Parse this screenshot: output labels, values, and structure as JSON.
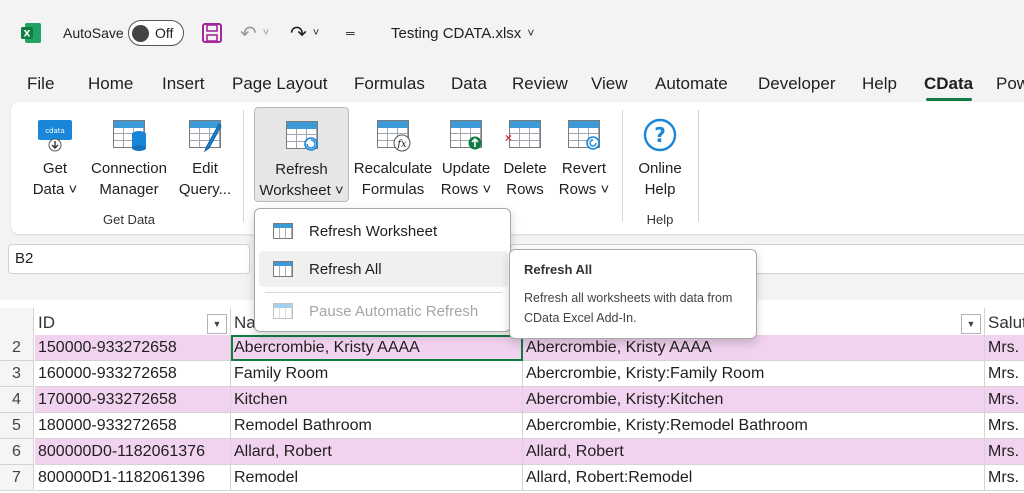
{
  "titlebar": {
    "autosave_label": "AutoSave",
    "autosave_state": "Off",
    "file_title": "Testing CDATA.xlsx"
  },
  "tabs": [
    {
      "label": "File"
    },
    {
      "label": "Home"
    },
    {
      "label": "Insert"
    },
    {
      "label": "Page Layout"
    },
    {
      "label": "Formulas"
    },
    {
      "label": "Data"
    },
    {
      "label": "Review"
    },
    {
      "label": "View"
    },
    {
      "label": "Automate"
    },
    {
      "label": "Developer"
    },
    {
      "label": "Help"
    },
    {
      "label": "CData"
    },
    {
      "label": "Pow"
    }
  ],
  "active_tab": "CData",
  "ribbon": {
    "get_data": {
      "line1": "Get",
      "line2": "Data ˅"
    },
    "connection_manager": {
      "line1": "Connection",
      "line2": "Manager"
    },
    "edit_query": {
      "line1": "Edit",
      "line2": "Query..."
    },
    "group_get_data": "Get Data",
    "refresh_worksheet": {
      "line1": "Refresh",
      "line2": "Worksheet ˅"
    },
    "recalculate": {
      "line1": "Recalculate",
      "line2": "Formulas"
    },
    "update_rows": {
      "line1": "Update",
      "line2": "Rows ˅"
    },
    "delete_rows": {
      "line1": "Delete",
      "line2": "Rows"
    },
    "revert_rows": {
      "line1": "Revert",
      "line2": "Rows ˅"
    },
    "online_help": {
      "line1": "Online",
      "line2": "Help"
    },
    "group_help": "Help"
  },
  "namebox": "B2",
  "dropdown": {
    "items": [
      {
        "label": "Refresh Worksheet",
        "state": "normal"
      },
      {
        "label": "Refresh All",
        "state": "hover"
      },
      {
        "label": "Pause Automatic Refresh",
        "state": "disabled"
      }
    ]
  },
  "tooltip": {
    "title": "Refresh All",
    "body": "Refresh all worksheets with data from CData Excel Add-In."
  },
  "sheet": {
    "headers": [
      "ID",
      "Na",
      "",
      "Salut"
    ],
    "rows": [
      {
        "num": "2",
        "id": "150000-933272658",
        "name": "Abercrombie, Kristy AAAA",
        "full": "Abercrombie, Kristy AAAA",
        "sal": "Mrs."
      },
      {
        "num": "3",
        "id": "160000-933272658",
        "name": "Family Room",
        "full": "Abercrombie, Kristy:Family Room",
        "sal": "Mrs."
      },
      {
        "num": "4",
        "id": "170000-933272658",
        "name": "Kitchen",
        "full": "Abercrombie, Kristy:Kitchen",
        "sal": "Mrs."
      },
      {
        "num": "5",
        "id": "180000-933272658",
        "name": "Remodel Bathroom",
        "full": "Abercrombie, Kristy:Remodel Bathroom",
        "sal": "Mrs."
      },
      {
        "num": "6",
        "id": "800000D0-1182061376",
        "name": "Allard, Robert",
        "full": "Allard, Robert",
        "sal": "Mrs."
      },
      {
        "num": "7",
        "id": "800000D1-1182061396",
        "name": "Remodel",
        "full": "Allard, Robert:Remodel",
        "sal": "Mrs."
      }
    ]
  },
  "colors": {
    "excel_green": "#107c41",
    "band": "#f1d2ef",
    "accent_blue": "#1a86d9"
  }
}
